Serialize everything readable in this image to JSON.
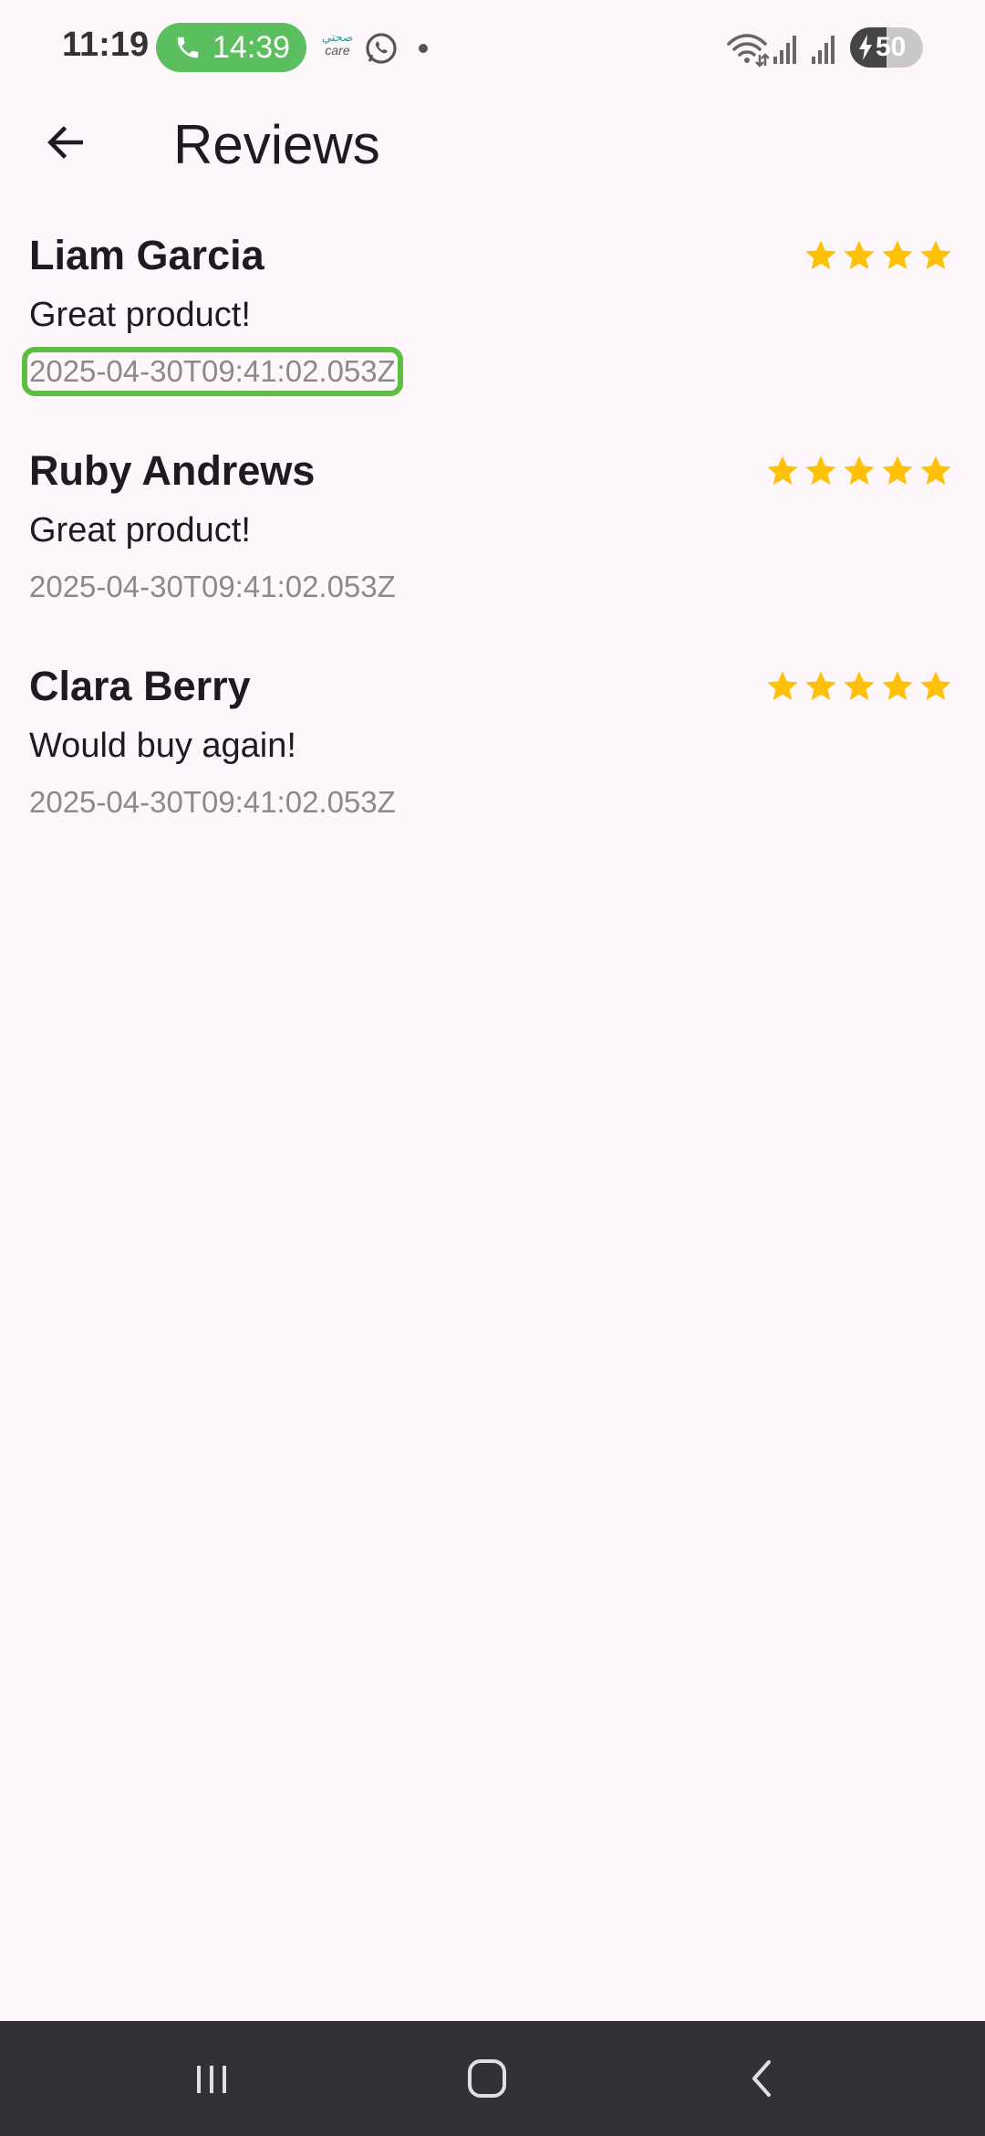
{
  "status_bar": {
    "time": "11:19",
    "call_timer": "14:39",
    "care_app_arabic": "صحتي",
    "care_app_label": "care",
    "battery_percent": "50",
    "battery_level": 0.5,
    "icons": [
      "phone-icon",
      "care-app-icon",
      "whatsapp-icon",
      "notification-dot",
      "wifi-icon",
      "signal-icon",
      "signal-icon",
      "battery-icon"
    ]
  },
  "app_bar": {
    "title": "Reviews",
    "back_icon": "arrow-left-icon"
  },
  "reviews": [
    {
      "name": "Liam Garcia",
      "rating": 4,
      "comment": "Great product!",
      "date": "2025-04-30T09:41:02.053Z",
      "highlighted": true
    },
    {
      "name": "Ruby Andrews",
      "rating": 5,
      "comment": "Great product!",
      "date": "2025-04-30T09:41:02.053Z",
      "highlighted": false
    },
    {
      "name": "Clara Berry",
      "rating": 5,
      "comment": "Would buy again!",
      "date": "2025-04-30T09:41:02.053Z",
      "highlighted": false
    }
  ],
  "colors": {
    "background": "#fdf7fc",
    "star": "#ffc107",
    "highlight": "#5cbf3f",
    "call_pill": "#5cbf5f",
    "nav_bar": "#323135"
  },
  "nav_bar": {
    "icons": [
      "recent-apps-icon",
      "home-icon",
      "back-icon"
    ]
  }
}
